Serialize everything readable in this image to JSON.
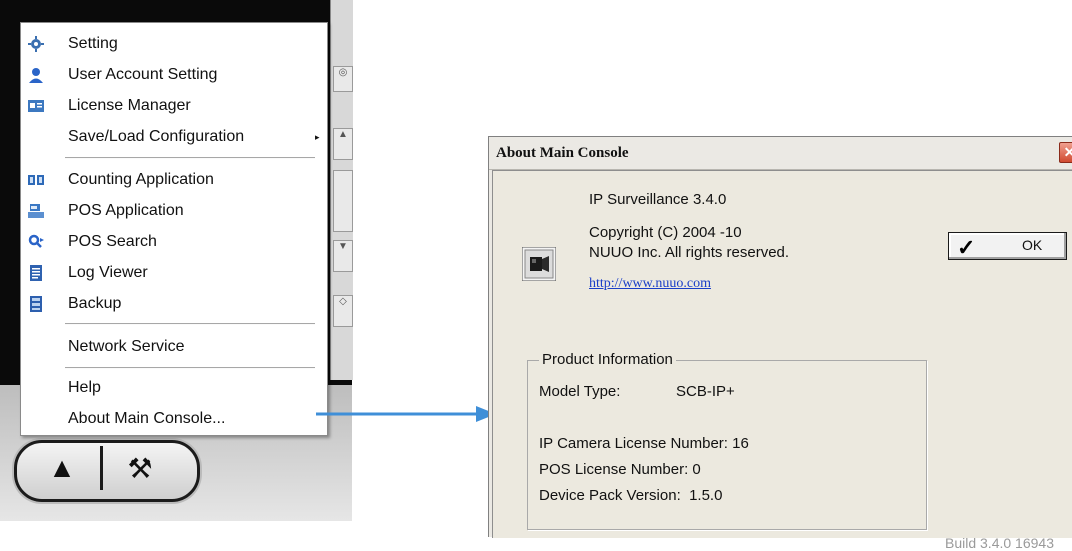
{
  "menu": {
    "items": [
      {
        "label": "Setting",
        "icon": "gear-icon"
      },
      {
        "label": "User Account Setting",
        "icon": "user-icon"
      },
      {
        "label": "License Manager",
        "icon": "license-card-icon"
      },
      {
        "label": "Save/Load Configuration",
        "icon": "",
        "submenu_arrow": "▸"
      },
      {
        "label": "Counting Application",
        "icon": "counting-icon"
      },
      {
        "label": "POS Application",
        "icon": "pos-terminal-icon"
      },
      {
        "label": "POS Search",
        "icon": "pos-search-icon"
      },
      {
        "label": "Log Viewer",
        "icon": "log-document-icon"
      },
      {
        "label": "Backup",
        "icon": "backup-icon"
      },
      {
        "label": "Network Service",
        "icon": ""
      },
      {
        "label": "Help",
        "icon": ""
      },
      {
        "label": "About Main Console...",
        "icon": ""
      }
    ]
  },
  "dialog": {
    "title": "About Main Console",
    "close_label": "✕",
    "product_name": "IP Surveillance 3.4.0",
    "copyright": "Copyright (C) 2004 -10",
    "rights": "NUUO Inc. All rights reserved.",
    "link": "http://www.nuuo.com",
    "ok_label": "OK",
    "ok_check": "✓",
    "product_info": {
      "legend": "Product Information",
      "model_label": "Model Type:",
      "model_value": "SCB-IP+",
      "ip_camera": "IP Camera License Number: 16",
      "pos_license": "POS License Number: 0",
      "device_pack": "Device Pack Version:  1.5.0"
    },
    "build": "Build 3.4.0 16943"
  },
  "colors": {
    "connector": "#3f8fd8",
    "link": "#1a3ec8",
    "close": "#d04a30",
    "dialog_bg": "#ece9df"
  },
  "toolbar": {
    "warning_icon": "▲",
    "tool_icon": "⚒"
  }
}
